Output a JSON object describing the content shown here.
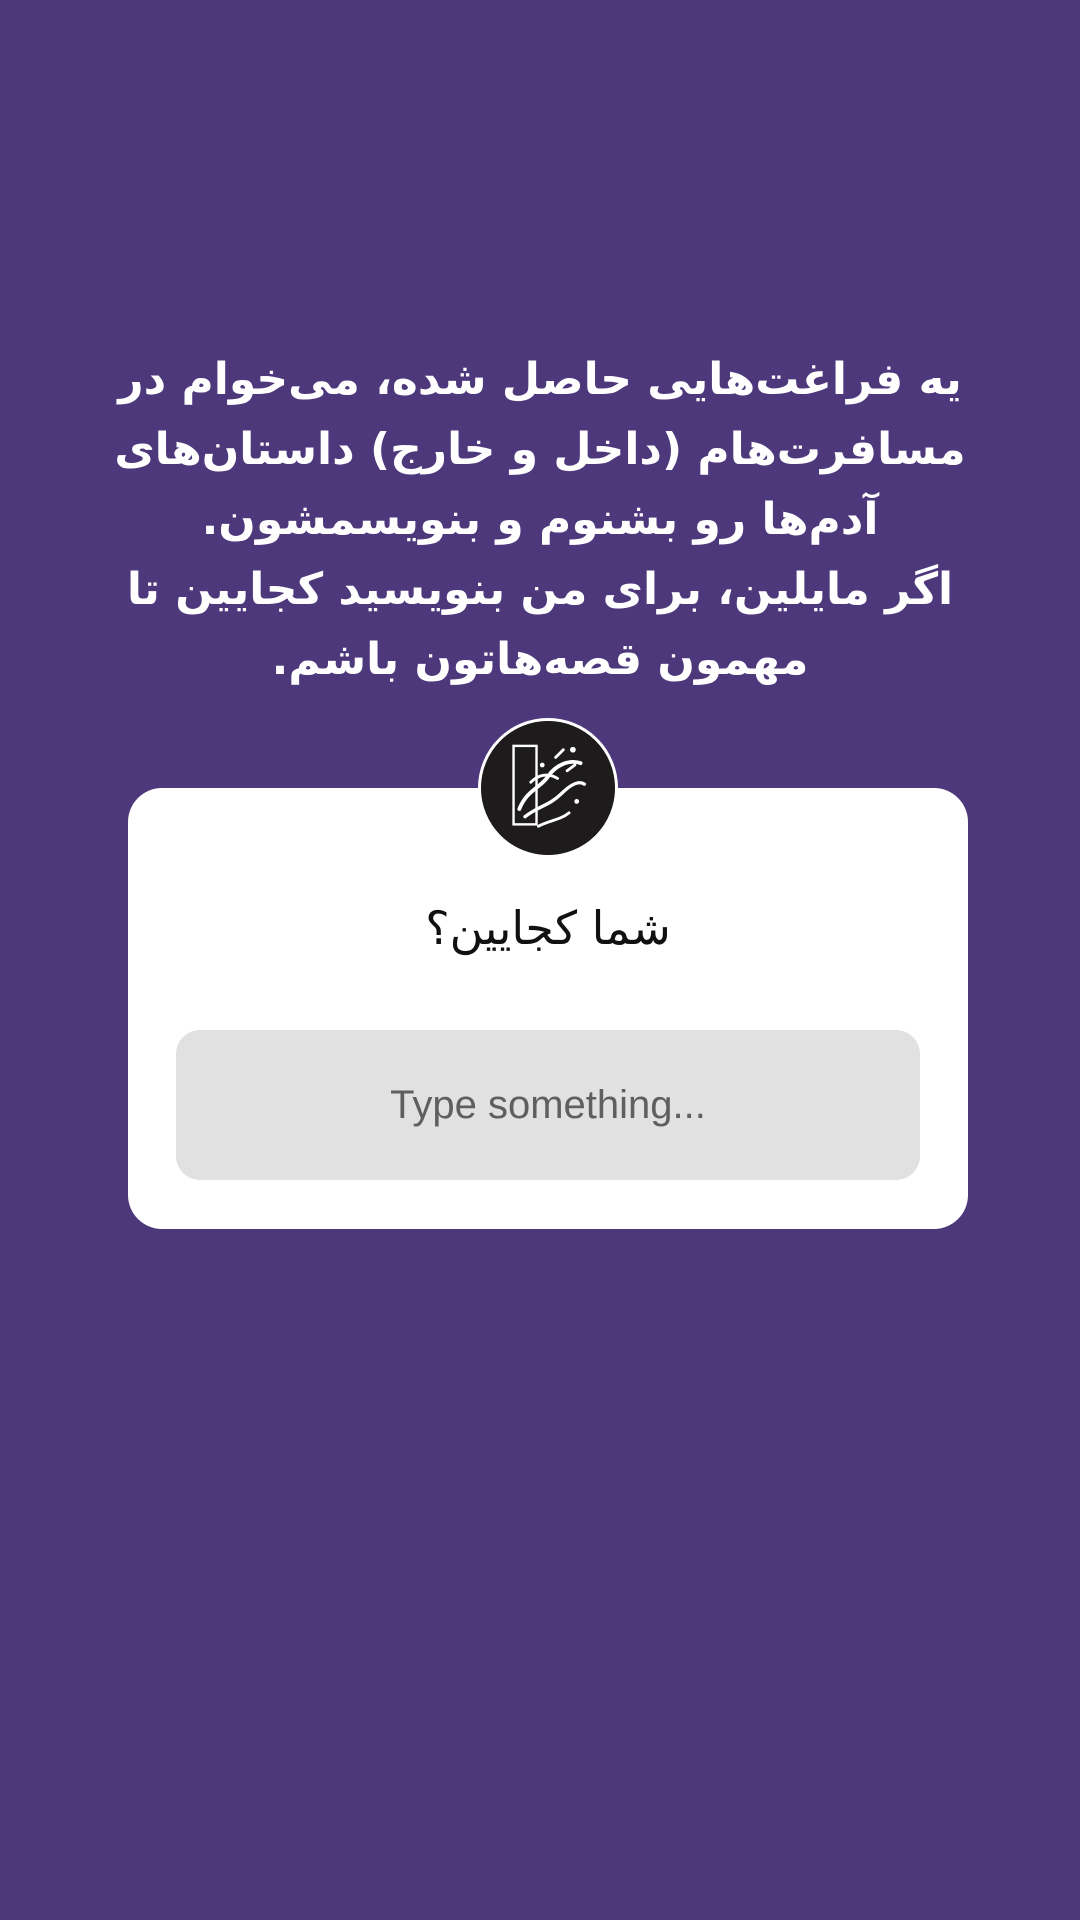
{
  "story": {
    "background_color": "#4e387c",
    "caption_lines": [
      "یه فراغت‌هایی حاصل شده، می‌خوام در",
      "مسافرت‌هام (داخل و خارج) داستان‌های",
      "آدم‌ها رو بشنوم و بنویسمشون.",
      "اگر مایلین، برای من بنویسید کجایین تا",
      "مهمون قصه‌هاتون باشم."
    ]
  },
  "question_sticker": {
    "avatar": "profile-logo-calligraphy",
    "question": "شما کجایین؟",
    "answer_placeholder": "Type something..."
  }
}
